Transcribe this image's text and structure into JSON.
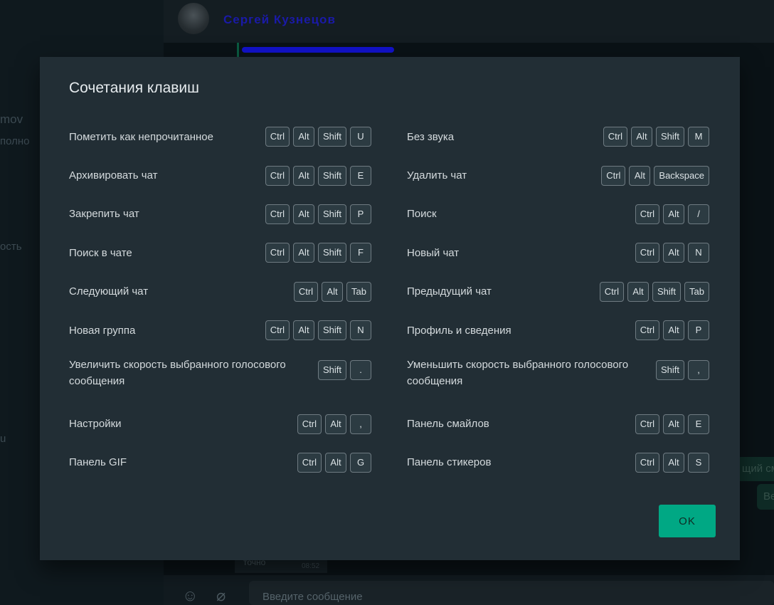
{
  "background": {
    "sidebar_fragments": [
      "mov",
      "полно",
      "ость",
      "u"
    ],
    "contact_name": "Сергей Кузнецов",
    "bubbles": [
      "щий см",
      "Ве"
    ],
    "message_footer_text": "точно",
    "message_footer_time": "08:52",
    "composer_placeholder": "Введите сообщение",
    "composer_icons": [
      "emoji-icon",
      "attach-icon"
    ]
  },
  "modal": {
    "title": "Сочетания клавиш",
    "ok_label": "OK",
    "left_column": [
      {
        "label": "Пометить как непрочитанное",
        "keys": [
          "Ctrl",
          "Alt",
          "Shift",
          "U"
        ]
      },
      {
        "label": "Архивировать чат",
        "keys": [
          "Ctrl",
          "Alt",
          "Shift",
          "E"
        ]
      },
      {
        "label": "Закрепить чат",
        "keys": [
          "Ctrl",
          "Alt",
          "Shift",
          "P"
        ]
      },
      {
        "label": "Поиск в чате",
        "keys": [
          "Ctrl",
          "Alt",
          "Shift",
          "F"
        ]
      },
      {
        "label": "Следующий чат",
        "keys": [
          "Ctrl",
          "Alt",
          "Tab"
        ]
      },
      {
        "label": "Новая группа",
        "keys": [
          "Ctrl",
          "Alt",
          "Shift",
          "N"
        ]
      },
      {
        "label": "Увеличить скорость выбранного голосового сообщения",
        "keys": [
          "Shift",
          "."
        ]
      },
      {
        "label": "Настройки",
        "keys": [
          "Ctrl",
          "Alt",
          ","
        ]
      },
      {
        "label": "Панель GIF",
        "keys": [
          "Ctrl",
          "Alt",
          "G"
        ]
      }
    ],
    "right_column": [
      {
        "label": "Без звука",
        "keys": [
          "Ctrl",
          "Alt",
          "Shift",
          "M"
        ]
      },
      {
        "label": "Удалить чат",
        "keys": [
          "Ctrl",
          "Alt",
          "Backspace"
        ]
      },
      {
        "label": "Поиск",
        "keys": [
          "Ctrl",
          "Alt",
          "/"
        ]
      },
      {
        "label": "Новый чат",
        "keys": [
          "Ctrl",
          "Alt",
          "N"
        ]
      },
      {
        "label": "Предыдущий чат",
        "keys": [
          "Ctrl",
          "Alt",
          "Shift",
          "Tab"
        ]
      },
      {
        "label": "Профиль и сведения",
        "keys": [
          "Ctrl",
          "Alt",
          "P"
        ]
      },
      {
        "label": "Уменьшить скорость выбранного голосового сообщения",
        "keys": [
          "Shift",
          ","
        ]
      },
      {
        "label": "Панель смайлов",
        "keys": [
          "Ctrl",
          "Alt",
          "E"
        ]
      },
      {
        "label": "Панель стикеров",
        "keys": [
          "Ctrl",
          "Alt",
          "S"
        ]
      }
    ]
  },
  "colors": {
    "accent": "#00a884",
    "modal_bg": "#222e35",
    "key_border": "#6f7b82"
  }
}
